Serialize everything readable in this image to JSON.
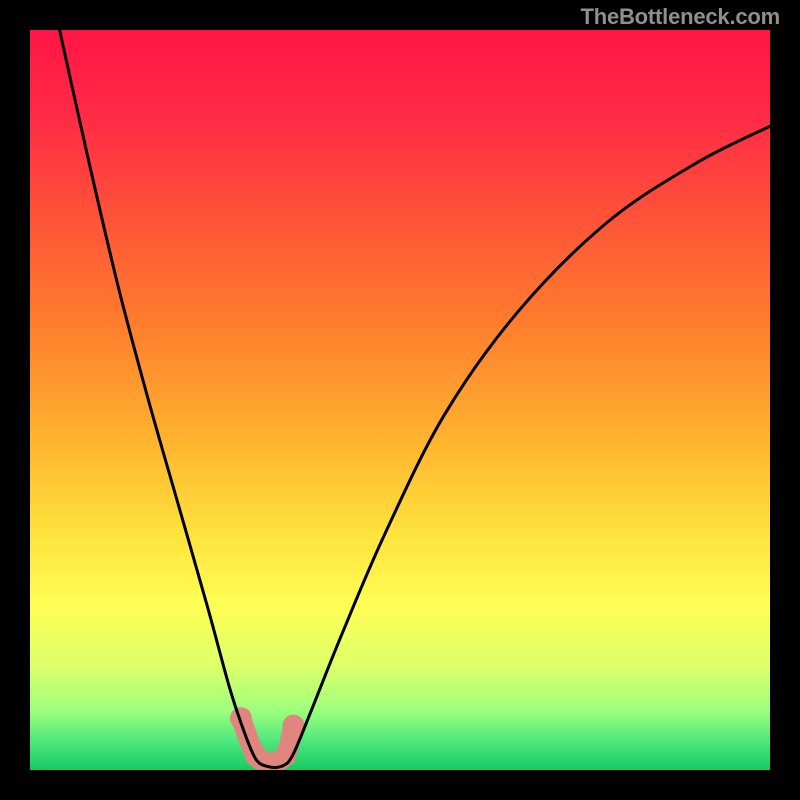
{
  "watermark": "TheBottleneck.com",
  "gradient_stops": [
    {
      "offset": 0.0,
      "color": "#ff1646"
    },
    {
      "offset": 0.12,
      "color": "#ff2b46"
    },
    {
      "offset": 0.25,
      "color": "#ff5238"
    },
    {
      "offset": 0.4,
      "color": "#ff7e2d"
    },
    {
      "offset": 0.55,
      "color": "#ffb22e"
    },
    {
      "offset": 0.68,
      "color": "#ffe23d"
    },
    {
      "offset": 0.78,
      "color": "#ffff55"
    },
    {
      "offset": 0.86,
      "color": "#dcff6a"
    },
    {
      "offset": 0.92,
      "color": "#9dff7c"
    },
    {
      "offset": 0.96,
      "color": "#4fe87d"
    },
    {
      "offset": 1.0,
      "color": "#18c964"
    }
  ],
  "chart_data": {
    "type": "line",
    "title": "",
    "xlabel": "",
    "ylabel": "",
    "xlim": [
      0,
      100
    ],
    "ylim": [
      0,
      100
    ],
    "series": [
      {
        "name": "bottleneck-curve",
        "x": [
          4,
          8,
          12,
          16,
          20,
          24,
          27,
          29,
          30.5,
          32,
          34,
          35.5,
          38,
          42,
          48,
          56,
          66,
          78,
          90,
          100
        ],
        "y": [
          100,
          82,
          65,
          50,
          36,
          22,
          11,
          5,
          1.5,
          0.5,
          0.5,
          2,
          8,
          18,
          32,
          48,
          62,
          74,
          82,
          87
        ]
      }
    ],
    "highlight": {
      "color": "#e0867e",
      "points_x": [
        28.5,
        30.5,
        32.5,
        34.5,
        35.6
      ],
      "points_y": [
        7,
        2,
        1,
        2,
        6
      ]
    }
  }
}
